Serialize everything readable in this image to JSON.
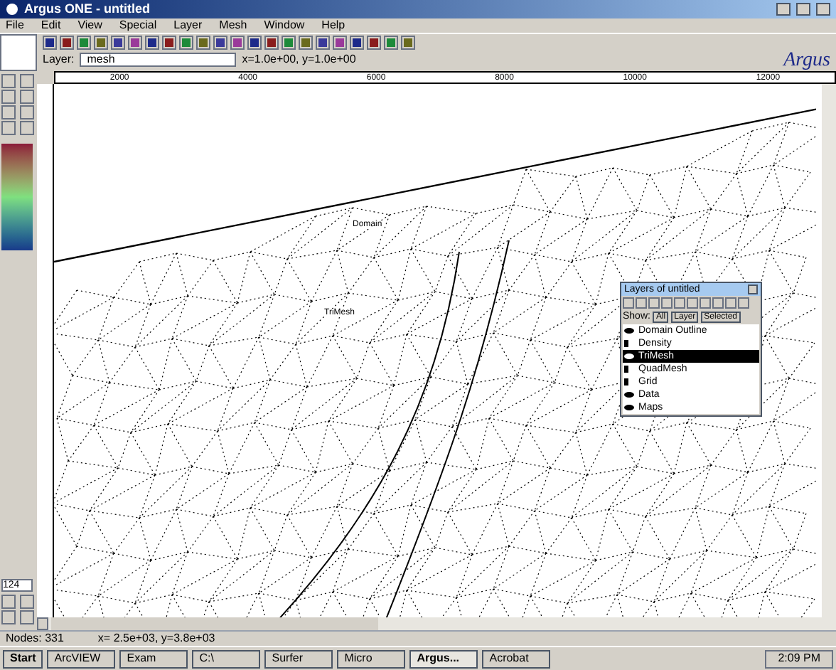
{
  "window": {
    "title": "Argus ONE - untitled"
  },
  "menu": [
    "File",
    "Edit",
    "View",
    "Special",
    "Layer",
    "Mesh",
    "Window",
    "Help"
  ],
  "layer_field": {
    "label": "Layer:",
    "value": "mesh"
  },
  "coordinates": "x=1.0e+00, y=1.0e+00",
  "ruler_ticks": [
    "2000",
    "4000",
    "6000",
    "8000",
    "10000",
    "12000"
  ],
  "logo": "Argus",
  "canvas_labels": [
    "Domain",
    "TriMesh"
  ],
  "layers_window": {
    "title": "Layers of untitled",
    "show_label": "Show:",
    "show_buttons": [
      "All",
      "Layer",
      "Selected"
    ],
    "layers": [
      {
        "name": "Domain Outline",
        "visible": true,
        "selected": false
      },
      {
        "name": "Density",
        "visible": false,
        "selected": false
      },
      {
        "name": "TriMesh",
        "visible": true,
        "selected": true
      },
      {
        "name": "QuadMesh",
        "visible": false,
        "selected": false
      },
      {
        "name": "Grid",
        "visible": false,
        "selected": false
      },
      {
        "name": "Data",
        "visible": true,
        "selected": false
      },
      {
        "name": "Maps",
        "visible": true,
        "selected": false
      }
    ]
  },
  "zoom_field": "124",
  "status_bar": [
    "Nodes: 331",
    "x= 2.5e+03, y=3.8e+03"
  ],
  "taskbar": {
    "start": "Start",
    "tasks": [
      {
        "label": "ArcVIEW",
        "selected": false
      },
      {
        "label": "Exam",
        "selected": false
      },
      {
        "label": "C:\\",
        "selected": false
      },
      {
        "label": "Surfer",
        "selected": false
      },
      {
        "label": "Micro",
        "selected": false
      },
      {
        "label": "Argus...",
        "selected": true
      },
      {
        "label": "Acrobat",
        "selected": false
      }
    ],
    "clock": "2:09 PM"
  }
}
